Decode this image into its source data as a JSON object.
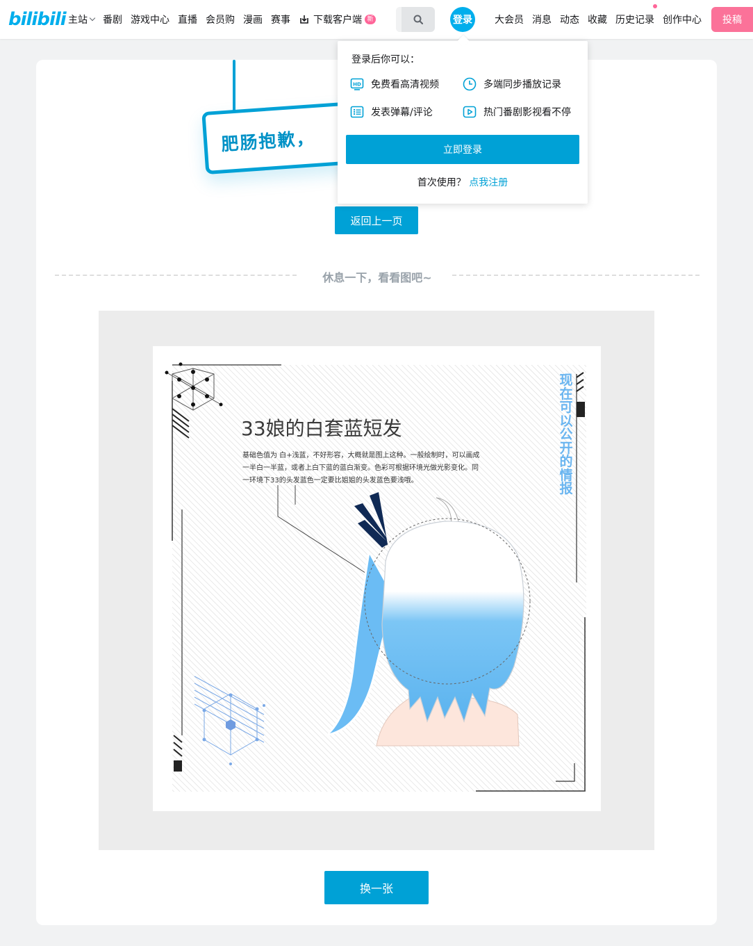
{
  "header": {
    "logo": "bilibili",
    "nav_left": [
      "主站",
      "番剧",
      "游戏中心",
      "直播",
      "会员购",
      "漫画",
      "赛事"
    ],
    "download_label": "下载客户端",
    "new_badge": "新",
    "login_label": "登录",
    "nav_right": [
      "大会员",
      "消息",
      "动态",
      "收藏",
      "历史记录",
      "创作中心"
    ],
    "upload_label": "投稿"
  },
  "error": {
    "sign_text": "肥肠抱歉，",
    "back_button": "返回上一页",
    "divider_text": "休息一下，看看图吧~",
    "swap_button": "换一张"
  },
  "picture": {
    "title": "33娘的白套蓝短发",
    "description": "基础色值为 白+浅蓝，不好形容，大概就是图上这种。一般绘制时，可以画成一半白一半蓝，或者上白下蓝的蓝白渐变。色彩可根据环境光做光影变化。同一环境下33的头发蓝色一定要比姐姐的头发蓝色要浅哦。",
    "vertical_text": "现在可以公开的情报"
  },
  "login_popup": {
    "title": "登录后你可以：",
    "benefits": [
      "免费看高清视频",
      "多端同步播放记录",
      "发表弹幕/评论",
      "热门番剧影视看不停"
    ],
    "login_button": "立即登录",
    "first_use": "首次使用？",
    "register_link": "点我注册"
  },
  "colors": {
    "brand_blue": "#00a1d6",
    "pink": "#fb7299",
    "page_bg": "#f1f2f3"
  },
  "icons": [
    "search-icon",
    "download-icon",
    "hd-icon",
    "clock-icon",
    "danmaku-list-icon",
    "play-icon"
  ]
}
